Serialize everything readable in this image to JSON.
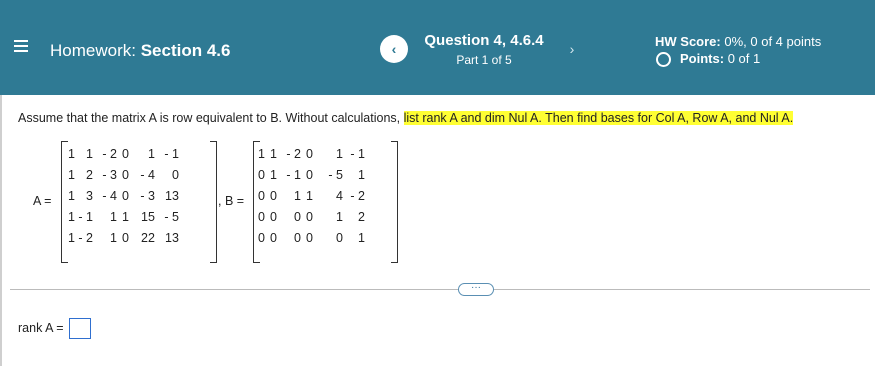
{
  "header": {
    "homework_prefix": "Homework:",
    "homework_section": "Section 4.6",
    "question_title": "Question 4, 4.6.4",
    "question_part": "Part 1 of 5",
    "prev_icon": "‹",
    "next_icon": "›",
    "hw_score_label": "HW Score:",
    "hw_score_value": "0%, 0 of 4 points",
    "points_label": "Points:",
    "points_value": "0 of 1",
    "bg_color": "#2f7a94"
  },
  "question": {
    "text_plain": "Assume that the matrix A is row equivalent to B. Without calculations,",
    "text_highlight": "list rank A and dim Nul A. Then find bases for Col A, Row A, and Nul A.",
    "highlight_color": "#ffff33"
  },
  "matrix_a": {
    "label": "A =",
    "rows": [
      [
        "1",
        "1",
        "- 2",
        "0",
        "1",
        "- 1"
      ],
      [
        "1",
        "2",
        "- 3",
        "0",
        "- 4",
        "0"
      ],
      [
        "1",
        "3",
        "- 4",
        "0",
        "- 3",
        "13"
      ],
      [
        "1",
        "- 1",
        "1",
        "1",
        "15",
        "- 5"
      ],
      [
        "1",
        "- 2",
        "1",
        "0",
        "22",
        "13"
      ]
    ]
  },
  "matrix_b": {
    "label": ", B =",
    "rows": [
      [
        "1",
        "1",
        "- 2",
        "0",
        "1",
        "- 1"
      ],
      [
        "0",
        "1",
        "- 1",
        "0",
        "- 5",
        "1"
      ],
      [
        "0",
        "0",
        "1",
        "1",
        "4",
        "- 2"
      ],
      [
        "0",
        "0",
        "0",
        "0",
        "1",
        "2"
      ],
      [
        "0",
        "0",
        "0",
        "0",
        "0",
        "1"
      ]
    ]
  },
  "more_button": "···",
  "answer": {
    "rank_label": "rank A =",
    "rank_value": ""
  }
}
